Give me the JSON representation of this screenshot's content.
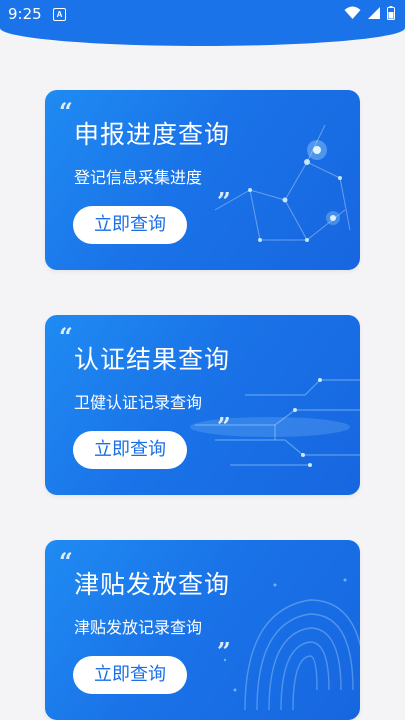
{
  "status_bar": {
    "time": "9:25",
    "notification_glyph": "A",
    "icons": [
      "wifi-icon",
      "signal-icon",
      "battery-icon"
    ]
  },
  "colors": {
    "header": "#1a73e8",
    "card_gradient_start": "#1f8bf2",
    "card_gradient_end": "#1766e0",
    "button_text": "#1a6fe6",
    "page_background": "#f4f4f6"
  },
  "cards": [
    {
      "title": "申报进度查询",
      "subtitle": "登记信息采集进度",
      "button_label": "立即查询",
      "quote_open": "“",
      "quote_close": "”",
      "background_icon": "network-nodes-decoration"
    },
    {
      "title": "认证结果查询",
      "subtitle": "卫健认证记录查询",
      "button_label": "立即查询",
      "quote_open": "“",
      "quote_close": "”",
      "background_icon": "circuit-lines-decoration"
    },
    {
      "title": "津贴发放查询",
      "subtitle": "津贴发放记录查询",
      "button_label": "立即查询",
      "quote_open": "“",
      "quote_close": "”",
      "background_icon": "fingerprint-decoration"
    }
  ]
}
